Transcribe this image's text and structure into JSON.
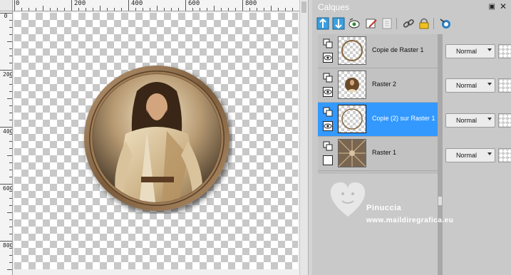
{
  "canvas": {
    "ruler_top_labels": [
      "0",
      "200",
      "400",
      "600",
      "800"
    ],
    "ruler_left_labels": [
      "0",
      "200",
      "400",
      "600",
      "800"
    ]
  },
  "panel": {
    "title": "Calques",
    "toolbar_icons": [
      "promote-layer-icon",
      "merge-down-icon",
      "new-mask-icon",
      "edit-layer-icon",
      "delete-layer-icon",
      "link-layer-icon",
      "lock-layer-icon",
      "layer-properties-icon"
    ]
  },
  "layers": [
    {
      "name": "Copie de Raster 1",
      "blend": "Normal",
      "visible": true,
      "selected": false
    },
    {
      "name": "Raster 2",
      "blend": "Normal",
      "visible": true,
      "selected": false
    },
    {
      "name": "Copie (2) sur Raster 1",
      "blend": "Normal",
      "visible": true,
      "selected": true
    },
    {
      "name": "Raster 1",
      "blend": "Normal",
      "visible": false,
      "selected": false
    }
  ],
  "watermark": {
    "line1": "Pinuccia",
    "line2": "www.maildiregrafica.eu"
  },
  "colors": {
    "selection": "#3399ff",
    "panel_bg": "#c9c9c9",
    "frame_gold": "#8a6d4a"
  }
}
